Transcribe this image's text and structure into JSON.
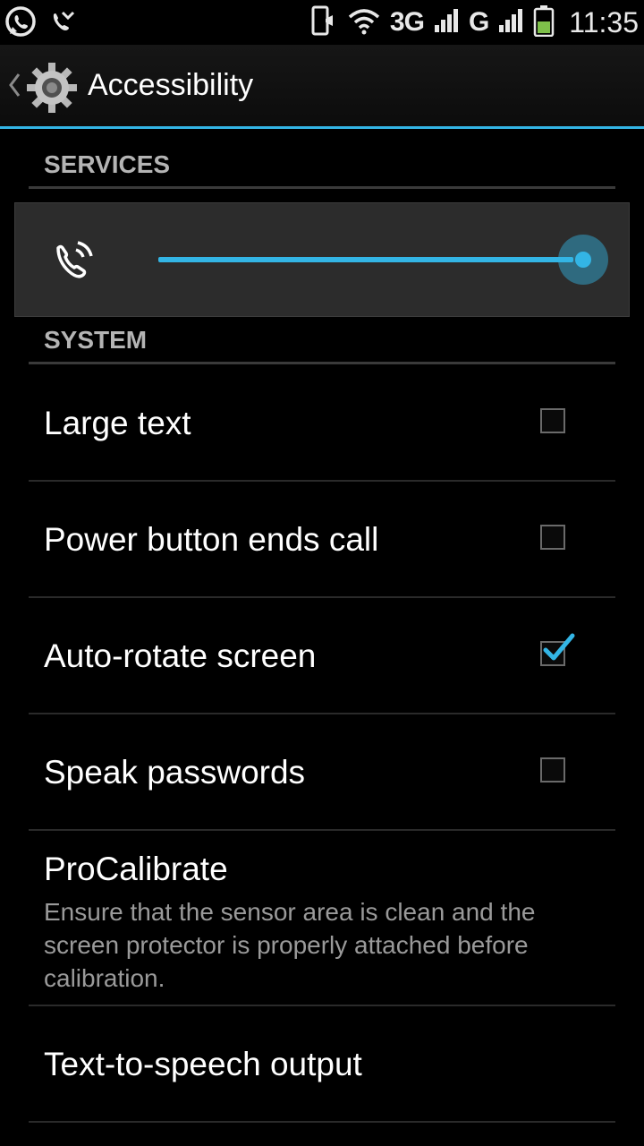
{
  "status_bar": {
    "left_icons": [
      "whatsapp-icon",
      "missed-call-icon"
    ],
    "network_1": "3G",
    "network_2": "G",
    "time": "11:35",
    "battery_color": "#7ec04a"
  },
  "action_bar": {
    "title": "Accessibility",
    "accent_color": "#33b5e5"
  },
  "sections": {
    "services": "SERVICES",
    "system": "SYSTEM"
  },
  "volume_panel": {
    "icon": "ringer-volume-icon",
    "level": 1.0
  },
  "settings": [
    {
      "title": "Large text",
      "checked": false
    },
    {
      "title": "Power button ends call",
      "checked": false
    },
    {
      "title": "Auto-rotate screen",
      "checked": true
    },
    {
      "title": "Speak passwords",
      "checked": false
    },
    {
      "title": "ProCalibrate",
      "summary": "Ensure that the sensor area is clean and the screen protector is properly attached before calibration."
    },
    {
      "title": "Text-to-speech output"
    }
  ]
}
